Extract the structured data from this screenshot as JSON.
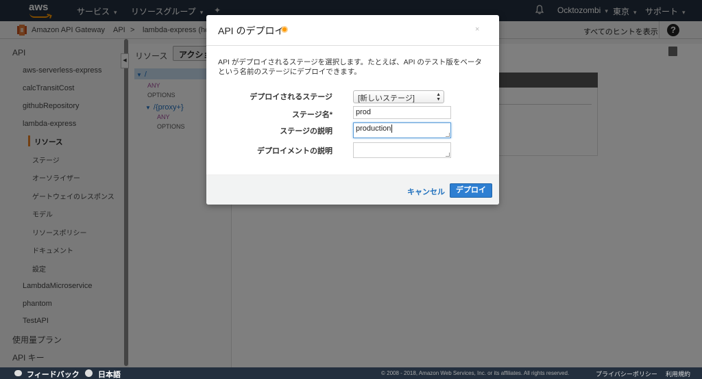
{
  "topnav": {
    "logo_text": "aws",
    "services": "サービス",
    "resource_groups": "リソースグループ",
    "account": "Ocktozombi",
    "region": "東京",
    "support": "サポート"
  },
  "subnav": {
    "service_name": "Amazon API Gateway",
    "crumb_api": "API",
    "crumb_sep": ">",
    "crumb_api_name": "lambda-express (hcil",
    "hints": "すべてのヒントを表示",
    "help": "?"
  },
  "sidebar": {
    "items": [
      {
        "label": "API",
        "level": 0
      },
      {
        "label": "aws-serverless-express",
        "level": 1
      },
      {
        "label": "calcTransitCost",
        "level": 1
      },
      {
        "label": "githubRepository",
        "level": 1
      },
      {
        "label": "lambda-express",
        "level": 1
      },
      {
        "label": "リソース",
        "level": 2,
        "active": true
      },
      {
        "label": "ステージ",
        "level": 2
      },
      {
        "label": "オーソライザー",
        "level": 2
      },
      {
        "label": "ゲートウェイのレスポンス",
        "level": 2
      },
      {
        "label": "モデル",
        "level": 2
      },
      {
        "label": "リソースポリシー",
        "level": 2
      },
      {
        "label": "ドキュメント",
        "level": 2
      },
      {
        "label": "設定",
        "level": 2
      },
      {
        "label": "LambdaMicroservice",
        "level": 1
      },
      {
        "label": "phantom",
        "level": 1
      },
      {
        "label": "TestAPI",
        "level": 1
      },
      {
        "label": "使用量プラン",
        "level": 0
      },
      {
        "label": "API キー",
        "level": 0
      }
    ]
  },
  "resources": {
    "title": "リソース",
    "actions_label": "アクション",
    "tree": {
      "root": "/",
      "root_any": "ANY",
      "root_options": "OPTIONS",
      "proxy": "/{proxy+}",
      "proxy_any": "ANY",
      "proxy_options": "OPTIONS"
    }
  },
  "modal": {
    "title": "API のデプロイ",
    "description": "API がデプロイされるステージを選択します。たとえば、API のテスト版をベータという名前のステージにデプロイできます。",
    "stage_label": "デプロイされるステージ",
    "stage_value": "[新しいステージ]",
    "stage_name_label": "ステージ名*",
    "stage_name_value": "prod",
    "stage_desc_label": "ステージの説明",
    "stage_desc_value": "production",
    "deploy_desc_label": "デプロイメントの説明",
    "deploy_desc_value": "",
    "cancel_label": "キャンセル",
    "deploy_label": "デプロイ"
  },
  "footer": {
    "feedback": "フィードバック",
    "language": "日本語",
    "copyright": "© 2008 - 2018, Amazon Web Services, Inc. or its affiliates. All rights reserved.",
    "privacy": "プライバシーポリシー",
    "terms": "利用規約"
  },
  "colors": {
    "nav_bg": "#232f3e",
    "accent": "#ff9900",
    "primary_button": "#2e7fd2",
    "link": "#1e6fbd"
  }
}
